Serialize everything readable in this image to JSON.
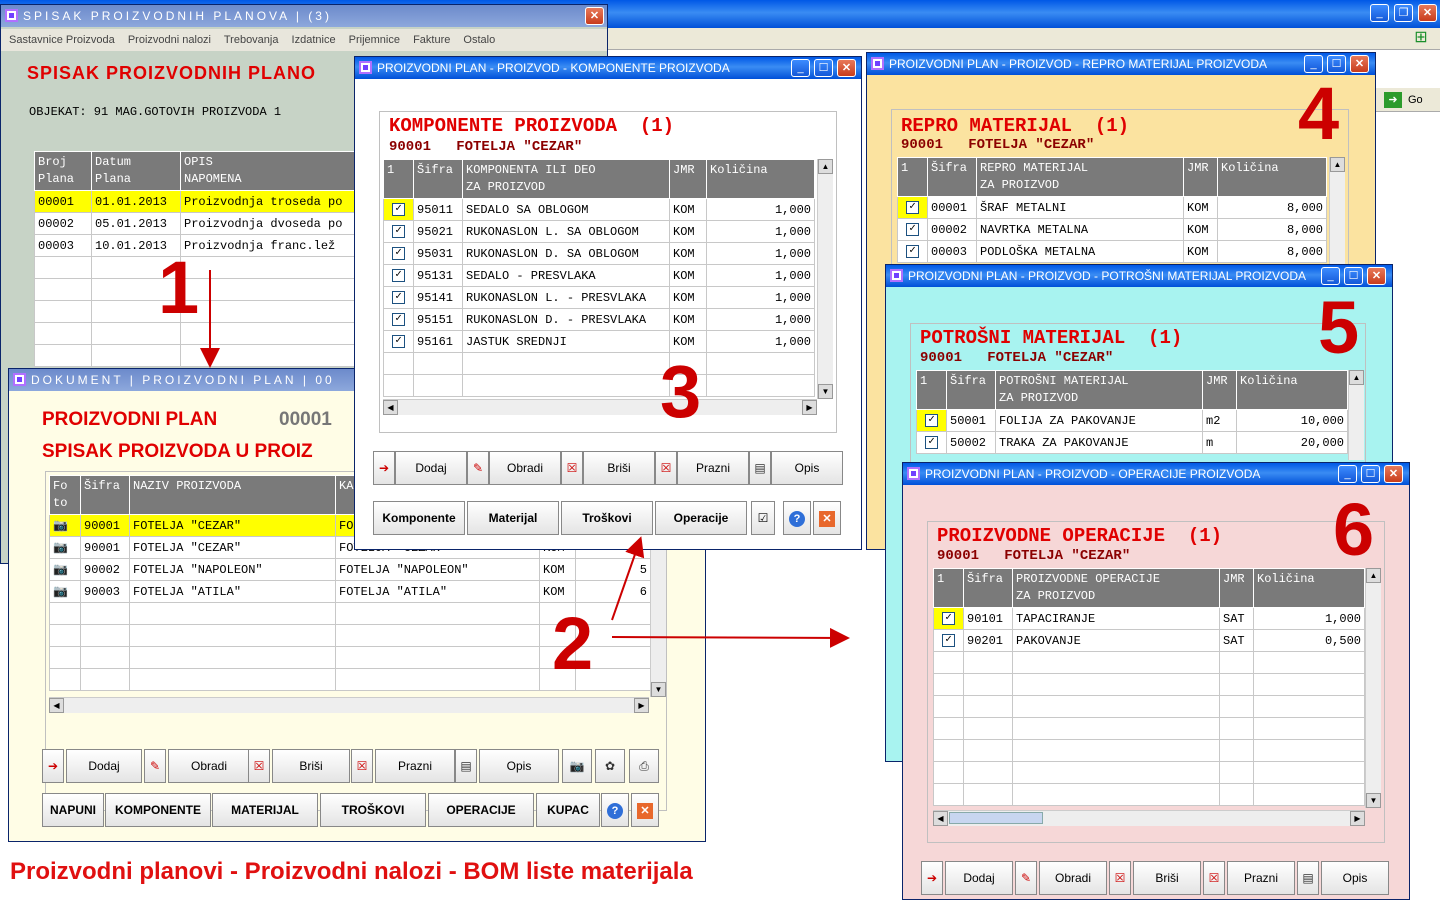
{
  "caption": "Proizvodni planovi - Proizvodni nalozi - BOM liste materijala",
  "bg_window": {
    "go": "Go"
  },
  "w1": {
    "title": "SPISAK PROIZVODNIH PLANOVA | (3)",
    "menu": [
      "Sastavnice Proizvoda",
      "Proizvodni nalozi",
      "Trebovanja",
      "Izdatnice",
      "Prijemnice",
      "Fakture",
      "Ostalo"
    ],
    "heading": "SPISAK PROIZVODNIH PLANO",
    "objekat": "OBJEKAT: 91 MAG.GOTOVIH PROIZVODA 1",
    "cols": [
      "Broj\nPlana",
      "Datum\nPlana",
      "OPIS\nNAPOMENA"
    ],
    "rows": [
      [
        "00001",
        "01.01.2013",
        "Proizvodnja troseda po"
      ],
      [
        "00002",
        "05.01.2013",
        "Proizvodnja dvoseda po"
      ],
      [
        "00003",
        "10.01.2013",
        "Proizvodnja franc.lež"
      ]
    ]
  },
  "w2": {
    "title": "DOKUMENT | PROIZVODNI PLAN | 00",
    "heading1": "PROIZVODNI PLAN",
    "number": "00001",
    "heading2": "SPISAK PROIZVODA U PROIZ",
    "cols": [
      "Fo\nto",
      "Šifra",
      "NAZIV PROIZVODA",
      "KA",
      ""
    ],
    "rows": [
      [
        "90001",
        "FOTELJA \"CEZAR\"",
        "FO",
        ""
      ],
      [
        "90001",
        "FOTELJA \"CEZAR\"",
        "FOTELJA \"CEZAR\"",
        "KOM"
      ],
      [
        "90002",
        "FOTELJA \"NAPOLEON\"",
        "FOTELJA \"NAPOLEON\"",
        "KOM"
      ],
      [
        "90003",
        "FOTELJA \"ATILA\"",
        "FOTELJA \"ATILA\"",
        "KOM"
      ]
    ],
    "row_nums": [
      "",
      "",
      "5",
      "6"
    ],
    "buttons": [
      "Dodaj",
      "Obradi",
      "Briši",
      "Prazni",
      "Opis"
    ],
    "bottom": [
      "NAPUNI",
      "KOMPONENTE",
      "MATERIJAL",
      "TROŠKOVI",
      "OPERACIJE",
      "KUPAC"
    ]
  },
  "w3": {
    "title": "PROIZVODNI PLAN - PROIZVOD - KOMPONENTE PROIZVODA",
    "heading": "KOMPONENTE PROIZVODA  (1)",
    "sub": "90001   FOTELJA \"CEZAR\"",
    "cols": [
      "1",
      "Šifra",
      "KOMPONENTA ILI DEO\nZA PROIZVOD",
      "JMR",
      "Količina"
    ],
    "rows": [
      [
        "95011",
        "SEDALO SA OBLOGOM",
        "KOM",
        "1,000"
      ],
      [
        "95021",
        "RUKONASLON L. SA OBLOGOM",
        "KOM",
        "1,000"
      ],
      [
        "95031",
        "RUKONASLON D. SA OBLOGOM",
        "KOM",
        "1,000"
      ],
      [
        "95131",
        "SEDALO - PRESVLAKA",
        "KOM",
        "1,000"
      ],
      [
        "95141",
        "RUKONASLON L. - PRESVLAKA",
        "KOM",
        "1,000"
      ],
      [
        "95151",
        "RUKONASLON D. - PRESVLAKA",
        "KOM",
        "1,000"
      ],
      [
        "95161",
        "JASTUK SREDNJI",
        "KOM",
        "1,000"
      ]
    ],
    "buttons": [
      "Dodaj",
      "Obradi",
      "Briši",
      "Prazni",
      "Opis"
    ],
    "bottom": [
      "Komponente",
      "Materijal",
      "Troškovi",
      "Operacije"
    ]
  },
  "w4": {
    "title": "PROIZVODNI PLAN - PROIZVOD - REPRO MATERIJAL PROIZVODA",
    "heading": "REPRO MATERIJAL  (1)",
    "sub": "90001   FOTELJA \"CEZAR\"",
    "cols": [
      "1",
      "Šifra",
      "REPRO MATERIJAL\nZA PROIZVOD",
      "JMR",
      "Količina"
    ],
    "rows": [
      [
        "00001",
        "ŠRAF METALNI",
        "KOM",
        "8,000"
      ],
      [
        "00002",
        "NAVRTKA METALNA",
        "KOM",
        "8,000"
      ],
      [
        "00003",
        "PODLOŠKA METALNA",
        "KOM",
        "8,000"
      ]
    ]
  },
  "w5": {
    "title": "PROIZVODNI PLAN - PROIZVOD - POTROŠNI MATERIJAL PROIZVODA",
    "heading": "POTROŠNI MATERIJAL  (1)",
    "sub": "90001   FOTELJA \"CEZAR\"",
    "cols": [
      "1",
      "Šifra",
      "POTROŠNI MATERIJAL\nZA PROIZVOD",
      "JMR",
      "Količina"
    ],
    "rows": [
      [
        "50001",
        "FOLIJA ZA PAKOVANJE",
        "m2",
        "10,000"
      ],
      [
        "50002",
        "TRAKA ZA PAKOVANJE",
        "m",
        "20,000"
      ]
    ]
  },
  "w6": {
    "title": "PROIZVODNI PLAN - PROIZVOD - OPERACIJE PROIZVODA",
    "heading": "PROIZVODNE OPERACIJE  (1)",
    "sub": "90001   FOTELJA \"CEZAR\"",
    "cols": [
      "1",
      "Šifra",
      "PROIZVODNE OPERACIJE\nZA PROIZVOD",
      "JMR",
      "Količina"
    ],
    "rows": [
      [
        "90101",
        "TAPACIRANJE",
        "SAT",
        "1,000"
      ],
      [
        "90201",
        "PAKOVANJE",
        "SAT",
        "0,500"
      ]
    ],
    "buttons": [
      "Dodaj",
      "Obradi",
      "Briši",
      "Prazni",
      "Opis"
    ]
  },
  "annotations": [
    "1",
    "2",
    "3",
    "4",
    "5",
    "6"
  ],
  "colors": {
    "title_red": "#e00000",
    "sub_red": "#8b0000",
    "w1_bg": "#c7d3c6",
    "w2_bg": "#fffde6",
    "w4_bg": "#fbe3a0",
    "w5_bg": "#a8f3f0",
    "w6_bg": "#f6d7d7",
    "selection": "#ffff00"
  }
}
